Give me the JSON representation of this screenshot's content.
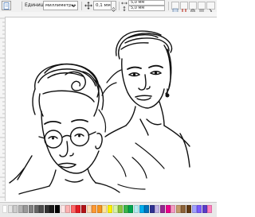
{
  "property_bar": {
    "units_label": "Единицы:",
    "units_value": "миллиметры",
    "nudge_value": "0,1 мм",
    "duplicate_x": "5,0 мм",
    "duplicate_y": "5,0 мм"
  },
  "palette": {
    "colors": [
      "#ffffff",
      "#e6e6e6",
      "#cccccc",
      "#b3b3b3",
      "#999999",
      "#808080",
      "#666666",
      "#4d4d4d",
      "#333333",
      "#1a1a1a",
      "#000000",
      "#ffe6e6",
      "#ffb3b3",
      "#ff6666",
      "#e31b23",
      "#b31217",
      "#ffd9b3",
      "#ff9933",
      "#f7941d",
      "#ffe699",
      "#fff200",
      "#d6f5a3",
      "#8dc63f",
      "#39b54a",
      "#00a651",
      "#b3ecf0",
      "#00aeef",
      "#0072bc",
      "#2e3192",
      "#c2b3e6",
      "#92278f",
      "#ec008c",
      "#f49ac1",
      "#c69c6d",
      "#8c6239",
      "#603913",
      "#a0a0ff",
      "#7a5cff",
      "#5a3cc8",
      "#ff80c0"
    ]
  }
}
